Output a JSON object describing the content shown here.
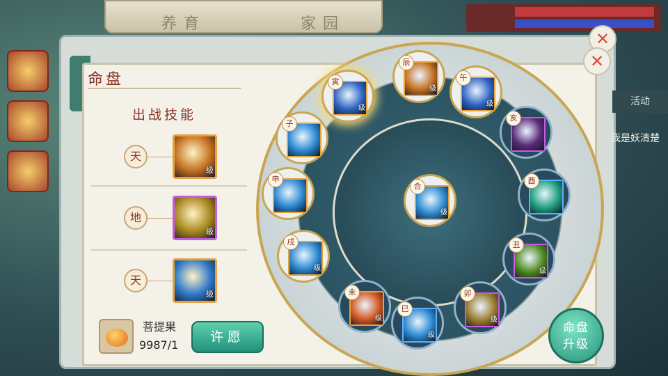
{
  "top_tabs": [
    "养育",
    "家园"
  ],
  "right_tab": "活动",
  "right_text": "我是妖清楚",
  "panel": {
    "title": "命盘",
    "skill_header": "出战技能"
  },
  "slots": [
    {
      "badge": "天",
      "level": "级",
      "color": "#c5701f",
      "border": "orange"
    },
    {
      "badge": "地",
      "level": "级",
      "color": "#a7861d",
      "border": "purple"
    },
    {
      "badge": "天",
      "level": "级",
      "color": "#2c78c8",
      "border": "orange"
    }
  ],
  "item": {
    "name": "菩提果",
    "count": "9987/1"
  },
  "buttons": {
    "wish": "许愿",
    "upgrade_line1": "命盘",
    "upgrade_line2": "升级",
    "close": "✕"
  },
  "center_node": {
    "tag": "合",
    "level": "级"
  },
  "nodes": [
    {
      "tag": "寅",
      "level": "级",
      "color": "#2f63c2",
      "style": "light",
      "border": "orange",
      "glow": true
    },
    {
      "tag": "辰",
      "level": "级",
      "color": "#c5701f",
      "style": "light",
      "border": "orange",
      "glow": false
    },
    {
      "tag": "午",
      "level": "级",
      "color": "#2f63c2",
      "style": "light",
      "border": "orange",
      "glow": false
    },
    {
      "tag": "子",
      "level": "",
      "color": "#2a87d0",
      "style": "light",
      "border": "orange",
      "glow": false
    },
    {
      "tag": "亥",
      "level": "",
      "color": "#5b2a7a",
      "style": "dark",
      "border": "purple",
      "glow": false
    },
    {
      "tag": "申",
      "level": "",
      "color": "#2a87d0",
      "style": "light",
      "border": "orange",
      "glow": false
    },
    {
      "tag": "酉",
      "level": "",
      "color": "#1f9f7d",
      "style": "dark",
      "border": "blue",
      "glow": false
    },
    {
      "tag": "戌",
      "level": "级",
      "color": "#2a87d0",
      "style": "light",
      "border": "orange",
      "glow": false
    },
    {
      "tag": "丑",
      "level": "级",
      "color": "#4f8a1c",
      "style": "dark",
      "border": "purple",
      "glow": false
    },
    {
      "tag": "未",
      "level": "级",
      "color": "#d4561f",
      "style": "dark",
      "border": "orange",
      "glow": false
    },
    {
      "tag": "巳",
      "level": "级",
      "color": "#2a87d0",
      "style": "dark",
      "border": "blue",
      "glow": false
    },
    {
      "tag": "卯",
      "level": "级",
      "color": "#9a7a2a",
      "style": "dark",
      "border": "purple",
      "glow": false
    }
  ]
}
